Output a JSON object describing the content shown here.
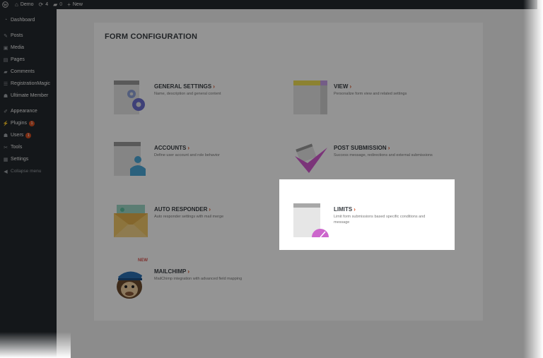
{
  "adminbar": {
    "site_name": "Demo",
    "updates_count": "4",
    "comments_count": "0",
    "new_label": "New"
  },
  "menu": {
    "items": [
      {
        "label": "Dashboard",
        "icon": "dashboard-icon"
      },
      {
        "label": "Posts",
        "icon": "pin-icon"
      },
      {
        "label": "Media",
        "icon": "media-icon"
      },
      {
        "label": "Pages",
        "icon": "pages-icon"
      },
      {
        "label": "Comments",
        "icon": "comment-icon"
      },
      {
        "label": "RegistrationMagic",
        "icon": "form-icon"
      },
      {
        "label": "Ultimate Member",
        "icon": "user-icon"
      },
      {
        "label": "Appearance",
        "icon": "brush-icon"
      },
      {
        "label": "Plugins",
        "icon": "plug-icon",
        "badge": "1"
      },
      {
        "label": "Users",
        "icon": "users-icon",
        "badge": "1"
      },
      {
        "label": "Tools",
        "icon": "wrench-icon"
      },
      {
        "label": "Settings",
        "icon": "settings-icon"
      },
      {
        "label": "Collapse menu",
        "icon": "collapse-icon"
      }
    ]
  },
  "page": {
    "title": "FORM CONFIGURATION"
  },
  "cards": [
    {
      "title": "GENERAL SETTINGS",
      "arrow": "›",
      "desc": "Name, description and general content"
    },
    {
      "title": "VIEW",
      "arrow": "›",
      "desc": "Personalize form view and related settings"
    },
    {
      "title": "ACCOUNTS",
      "arrow": "›",
      "desc": "Define user account and role behavior"
    },
    {
      "title": "POST SUBMISSION",
      "arrow": "›",
      "desc": "Success message, redirections and external submissions"
    },
    {
      "title": "AUTO RESPONDER",
      "arrow": "›",
      "desc": "Auto responder settings with mail merge"
    },
    {
      "title": "LIMITS",
      "arrow": "›",
      "desc": "Limit form submissions based specific conditions and message"
    },
    {
      "title": "MAILCHIMP",
      "arrow": "›",
      "desc": "MailChimp integration with advanced field mapping",
      "tag": "NEW"
    }
  ],
  "colors": {
    "admin_dark": "#23282d",
    "accent": "#d54e21",
    "dim": "rgba(0,0,0,0.42)"
  }
}
